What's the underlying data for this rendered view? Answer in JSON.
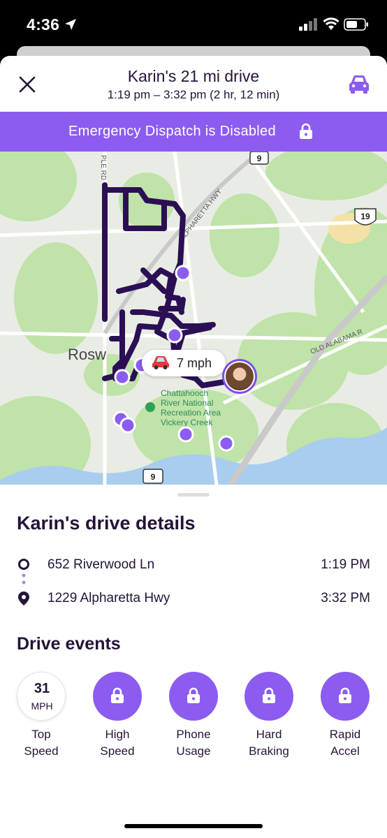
{
  "status_bar": {
    "time": "4:36"
  },
  "header": {
    "title": "Karin's 21 mi drive",
    "subtitle": "1:19 pm – 3:32 pm (2 hr, 12 min)"
  },
  "banner": {
    "text": "Emergency Dispatch is Disabled"
  },
  "map": {
    "labels": {
      "hwy9_top": "9",
      "alpharetta_hwy": "ALPHARETTA HWY",
      "us19": "19",
      "old_alabama": "OLD ALABAMA R",
      "roswell": "Rosw",
      "park": "Chattahooch River National Recreation Area Vickery Creek",
      "hwy9_bottom": "9",
      "maple_rd": "PLE RD"
    },
    "speed_chip": "7 mph",
    "colors": {
      "route": "#2b0f55",
      "stop": "#8c5cf0",
      "accent": "#8c5cf0"
    }
  },
  "drive_details": {
    "title": "Karin's drive details",
    "start": {
      "address": "652 Riverwood Ln",
      "time": "1:19 PM"
    },
    "end": {
      "address": "1229 Alpharetta Hwy",
      "time": "3:32 PM"
    }
  },
  "events": {
    "title": "Drive events",
    "items": [
      {
        "value": "31",
        "unit": "MPH",
        "label": "Top\nSpeed"
      },
      {
        "label": "High\nSpeed",
        "icon": "lock-icon"
      },
      {
        "label": "Phone\nUsage",
        "icon": "lock-icon"
      },
      {
        "label": "Hard\nBraking",
        "icon": "lock-icon"
      },
      {
        "label": "Rapid\nAccel",
        "icon": "lock-icon"
      }
    ]
  }
}
